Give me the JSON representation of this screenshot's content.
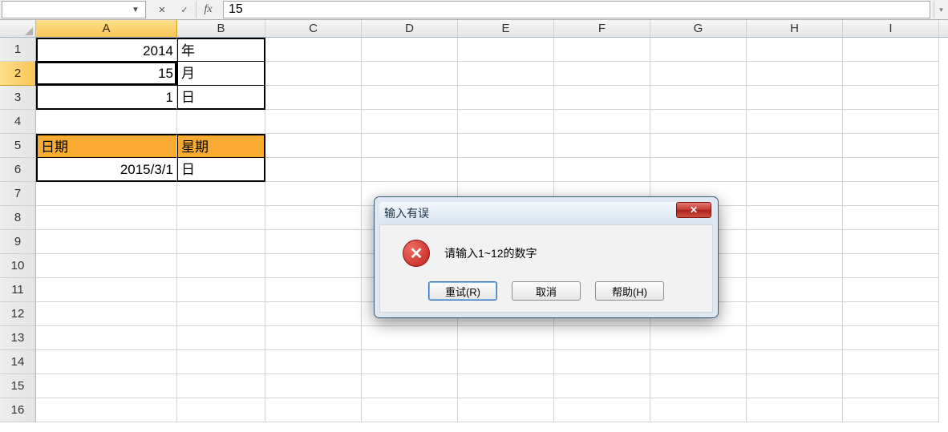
{
  "formula_bar": {
    "name_box_value": "",
    "fx_label": "fx",
    "formula_value": "15"
  },
  "columns": [
    "A",
    "B",
    "C",
    "D",
    "E",
    "F",
    "G",
    "H",
    "I"
  ],
  "active_column_index": 0,
  "active_row_index": 1,
  "row_count": 16,
  "cells": {
    "A1": "2014",
    "B1": "年",
    "A2": "15",
    "B2": "月",
    "A3": "1",
    "B3": "日",
    "A5": "日期",
    "B5": "星期",
    "A6": "2015/3/1",
    "B6": "日"
  },
  "dialog": {
    "title": "输入有误",
    "message": "请输入1~12的数字",
    "buttons": {
      "retry": "重试(R)",
      "cancel": "取消",
      "help": "帮助(H)"
    }
  }
}
